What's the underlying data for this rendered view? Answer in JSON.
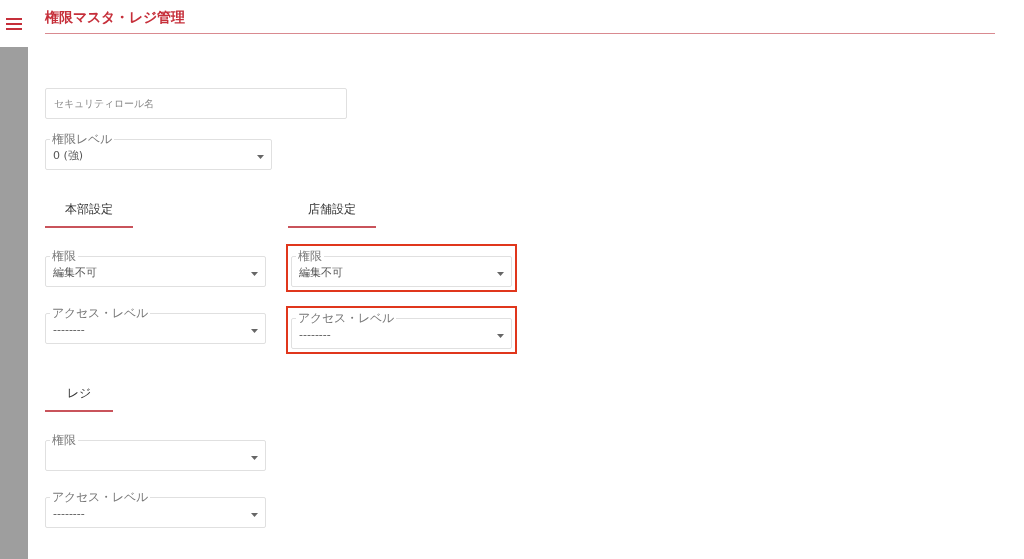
{
  "title": "権限マスタ・レジ管理",
  "role_name": {
    "placeholder": "セキュリティロール名"
  },
  "level_select": {
    "label": "権限レベル",
    "value": "0 (強)"
  },
  "section_rows": [
    [
      {
        "title": "本部設定",
        "fields": [
          {
            "label": "権限",
            "value": "編集不可",
            "highlighted": false
          },
          {
            "label": "アクセス・レベル",
            "value": "--------",
            "highlighted": false
          }
        ]
      },
      {
        "title": "店舗設定",
        "fields": [
          {
            "label": "権限",
            "value": "編集不可",
            "highlighted": true
          },
          {
            "label": "アクセス・レベル",
            "value": "--------",
            "highlighted": true
          }
        ]
      }
    ],
    [
      {
        "title": "レジ",
        "fields": [
          {
            "label": "権限",
            "highlighted": false
          },
          {
            "label": "アクセス・レベル",
            "value": "--------",
            "highlighted": false
          }
        ]
      }
    ]
  ]
}
